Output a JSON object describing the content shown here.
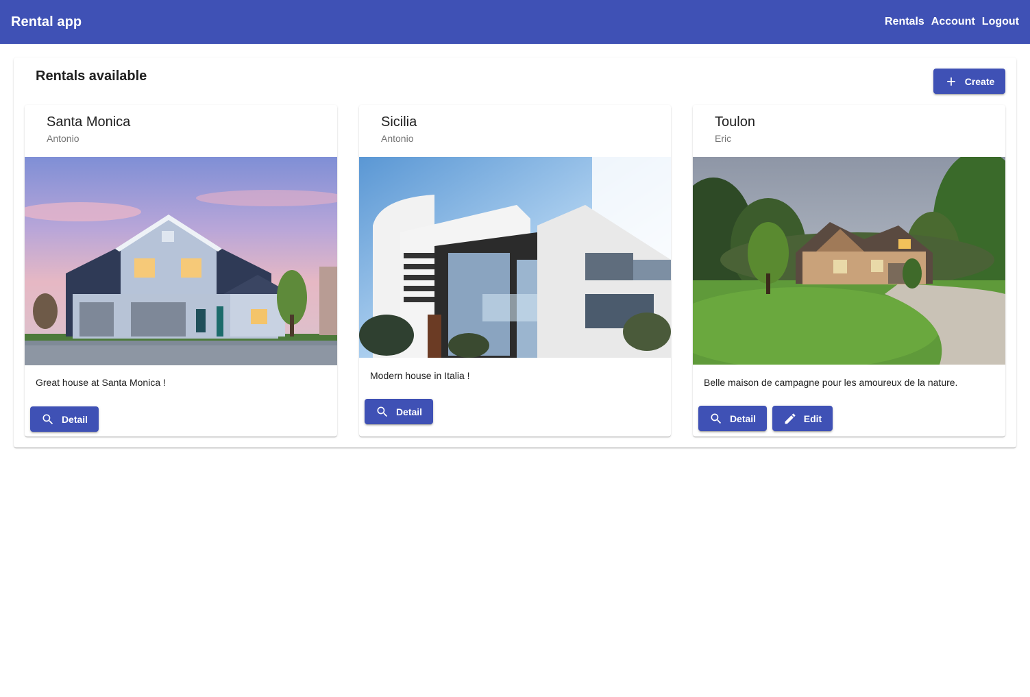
{
  "app": {
    "title": "Rental app",
    "nav": [
      {
        "label": "Rentals"
      },
      {
        "label": "Account"
      },
      {
        "label": "Logout"
      }
    ]
  },
  "page": {
    "title": "Rentals available",
    "create_label": "Create"
  },
  "rentals": [
    {
      "title": "Santa Monica",
      "owner": "Antonio",
      "description": "Great house at Santa Monica !",
      "actions": [
        {
          "label": "Detail",
          "icon": "search-icon"
        }
      ]
    },
    {
      "title": "Sicilia",
      "owner": "Antonio",
      "description": "Modern house in Italia !",
      "actions": [
        {
          "label": "Detail",
          "icon": "search-icon"
        }
      ]
    },
    {
      "title": "Toulon",
      "owner": "Eric",
      "description": "Belle maison de campagne pour les amoureux de la nature.",
      "actions": [
        {
          "label": "Detail",
          "icon": "search-icon"
        },
        {
          "label": "Edit",
          "icon": "pencil-icon"
        }
      ]
    }
  ],
  "colors": {
    "primary": "#3f51b5",
    "text": "#212121",
    "subtext": "#757575"
  }
}
